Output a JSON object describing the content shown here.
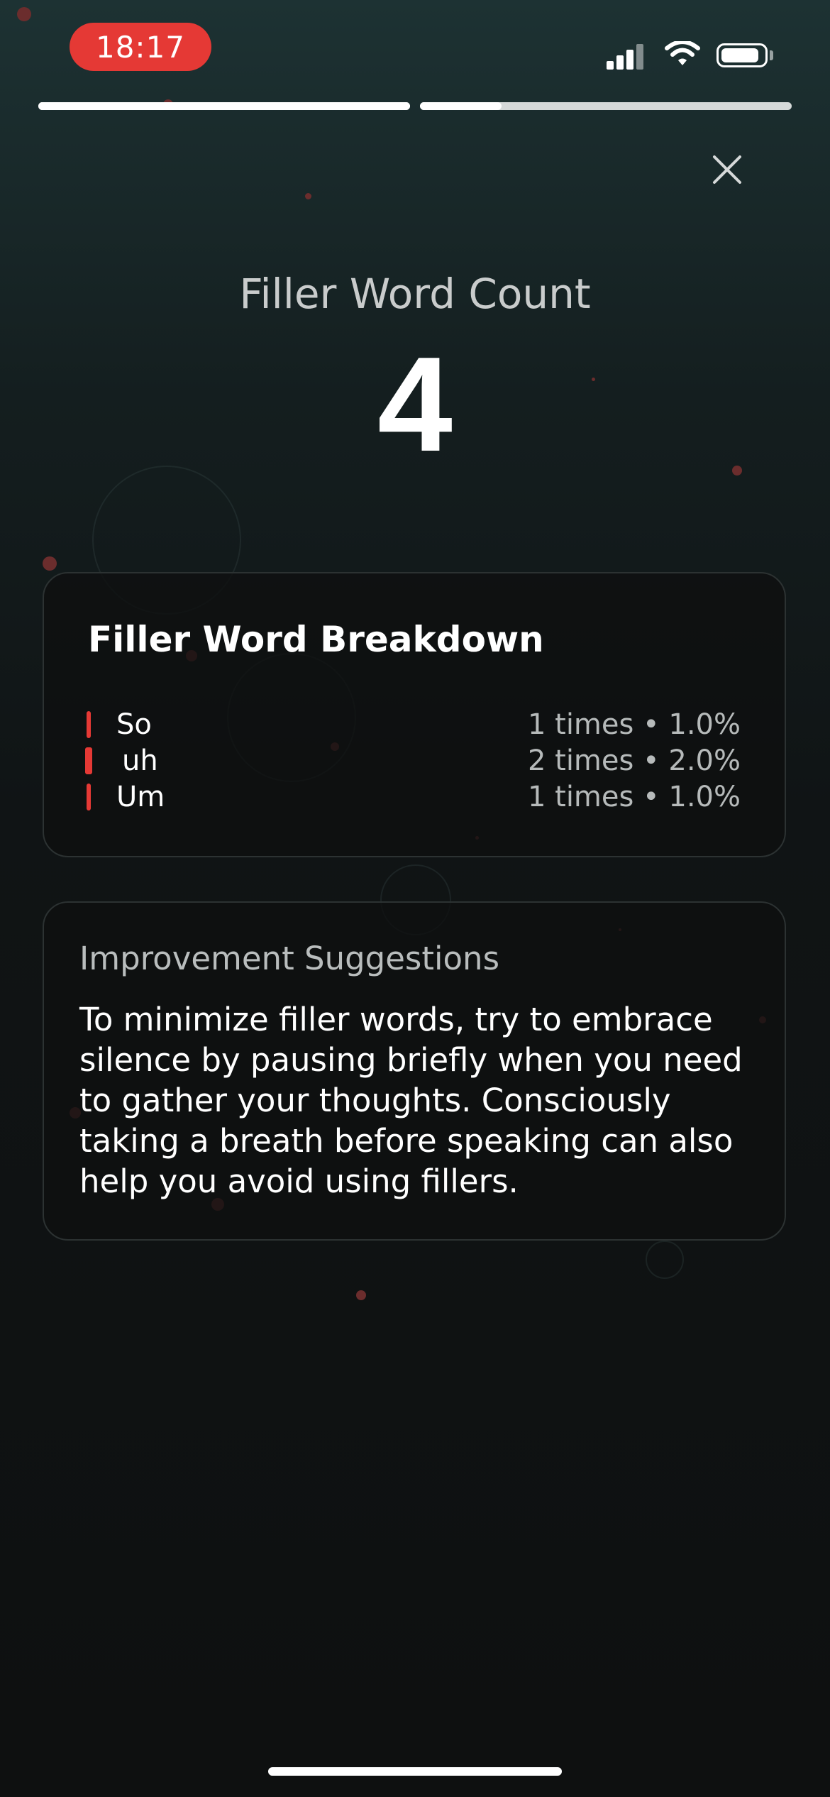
{
  "status_bar": {
    "time": "18:17",
    "icons": [
      "cellular-signal-icon",
      "wifi-icon",
      "battery-icon"
    ]
  },
  "progress": {
    "segments": [
      {
        "fill": 1.0
      },
      {
        "fill": 0.22
      }
    ]
  },
  "header": {
    "title": "Filler Word Count",
    "count": "4"
  },
  "breakdown": {
    "title": "Filler Word Breakdown",
    "items": [
      {
        "word": "So",
        "stats": "1 times • 1.0%"
      },
      {
        "word": "uh",
        "stats": "2 times • 2.0%"
      },
      {
        "word": "Um",
        "stats": "1 times • 1.0%"
      }
    ]
  },
  "suggestions": {
    "title": "Improvement Suggestions",
    "body": "To minimize filler words, try to embrace silence by pausing briefly when you need to gather your thoughts. Consciously taking a breath before speaking can also help you avoid using fillers."
  },
  "colors": {
    "accent": "#e53935",
    "background_top": "#1d3233",
    "background_bottom": "#0e1010"
  }
}
